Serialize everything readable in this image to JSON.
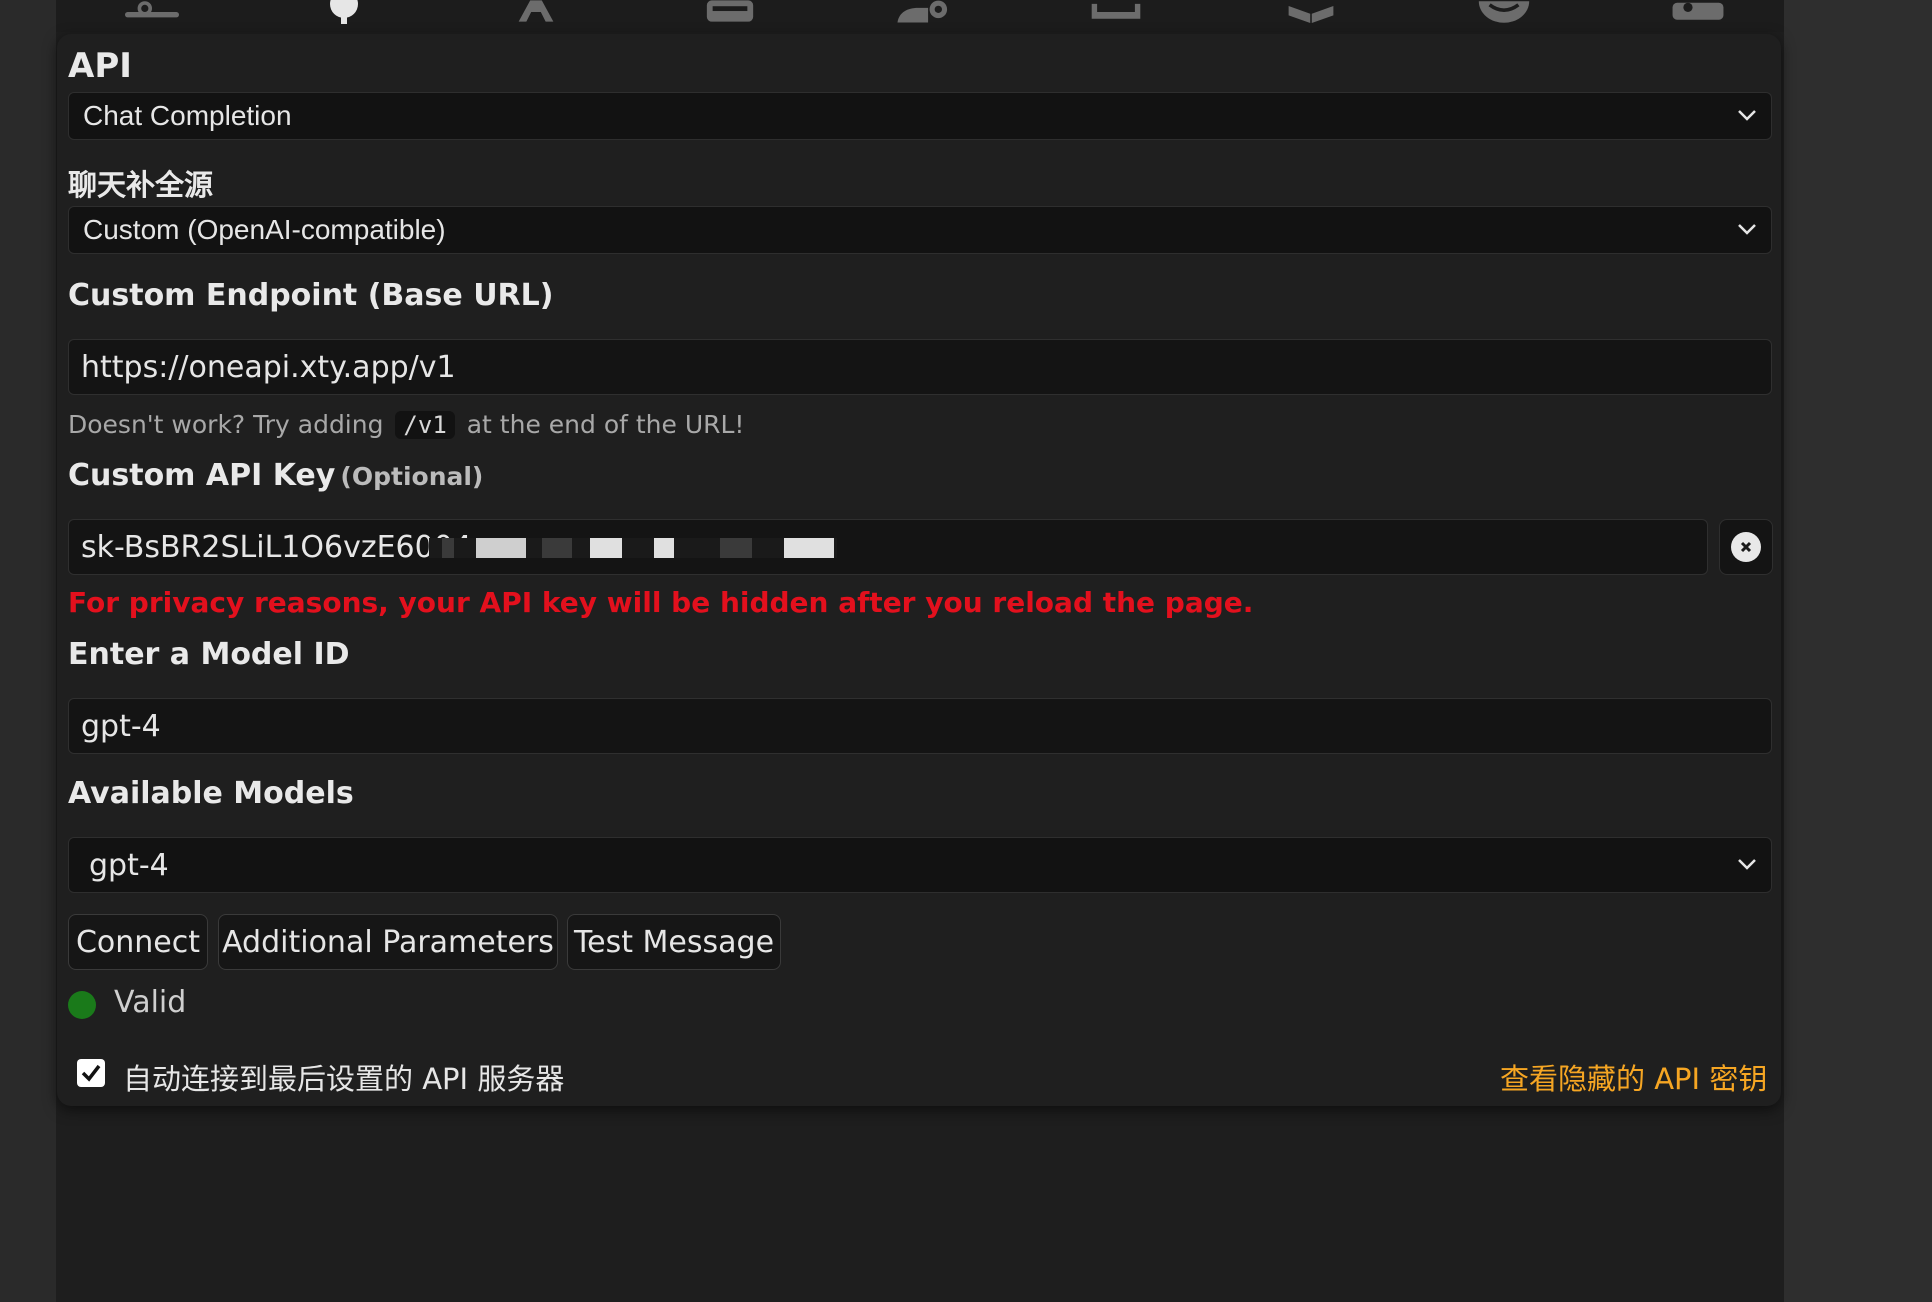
{
  "top_nav": {
    "icons": [
      "sliders-icon",
      "plug-icon",
      "font-icon",
      "book-icon",
      "user-cog-icon",
      "panel-icon",
      "cubes-icon",
      "smile-icon",
      "id-card-icon"
    ]
  },
  "api": {
    "label": "API",
    "selected": "Chat Completion"
  },
  "source": {
    "label": "聊天补全源",
    "selected": "Custom (OpenAI-compatible)"
  },
  "endpoint": {
    "label": "Custom Endpoint (Base URL)",
    "value": "https://oneapi.xty.app/v1",
    "hint_prefix": "Doesn't work? Try adding",
    "hint_code": "/v1",
    "hint_suffix": "at the end of the URL!"
  },
  "api_key": {
    "label": "Custom API Key",
    "optional": "(Optional)",
    "value_visible": "sk-BsBR2SLiL1O6vzE6004",
    "privacy_note": "For privacy reasons, your API key will be hidden after you reload the page."
  },
  "model": {
    "label": "Enter a Model ID",
    "value": "gpt-4"
  },
  "available_models": {
    "label": "Available Models",
    "selected": "gpt-4"
  },
  "buttons": {
    "connect": "Connect",
    "additional_parameters": "Additional Parameters",
    "test_message": "Test Message"
  },
  "status": {
    "text": "Valid",
    "color": "#1a7a1a"
  },
  "autoconnect": {
    "label": "自动连接到最后设置的 API 服务器",
    "checked": true
  },
  "hidden_keys_link": "查看隐藏的 API 密钥",
  "colors": {
    "warning": "#e3101d",
    "link": "#f6a623",
    "panel_bg": "#1f1f1f"
  }
}
